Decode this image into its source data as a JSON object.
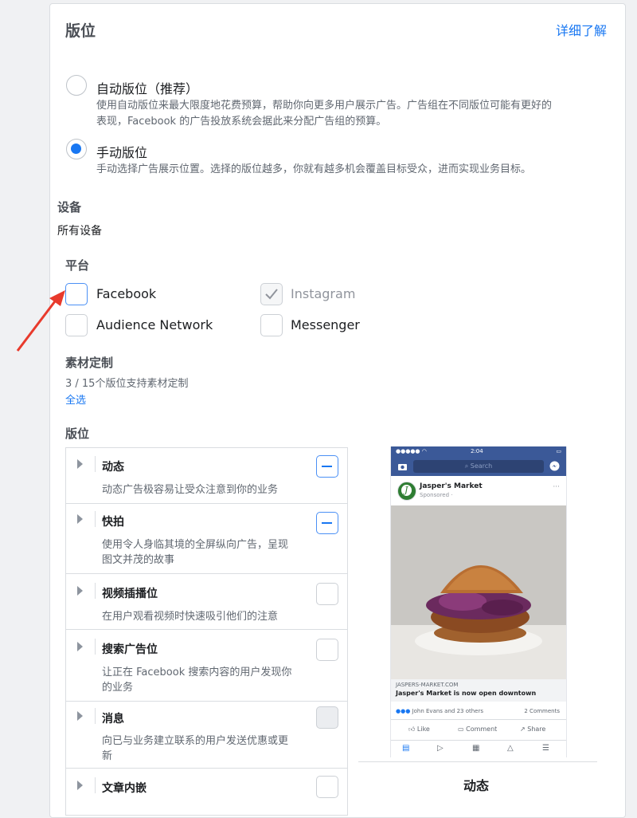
{
  "header": {
    "title": "版位",
    "learn_more": "详细了解"
  },
  "placement_mode": {
    "auto": {
      "label": "自动版位（推荐）",
      "desc_line1": "使用自动版位来最大限度地花费预算，帮助你向更多用户展示广告。广告组在不同版位可能有更好的",
      "desc_line2": "表现，Facebook 的广告投放系统会据此来分配广告组的预算。",
      "selected": false
    },
    "manual": {
      "label": "手动版位",
      "desc": "手动选择广告展示位置。选择的版位越多，你就有越多机会覆盖目标受众，进而实现业务目标。",
      "selected": true
    }
  },
  "devices": {
    "heading": "设备",
    "value": "所有设备"
  },
  "platforms": {
    "heading": "平台",
    "items": [
      {
        "label": "Facebook",
        "checked": false,
        "disabled": false
      },
      {
        "label": "Instagram",
        "checked": true,
        "disabled": true
      },
      {
        "label": "Audience Network",
        "checked": false,
        "disabled": false
      },
      {
        "label": "Messenger",
        "checked": false,
        "disabled": false
      }
    ]
  },
  "asset_customization": {
    "heading": "素材定制",
    "count_text": "3 / 15个版位支持素材定制",
    "select_all": "全选"
  },
  "placements": {
    "heading": "版位",
    "items": [
      {
        "name": "动态",
        "desc": "动态广告极容易让受众注意到你的业务",
        "state": "partial"
      },
      {
        "name": "快拍",
        "desc1": "使用令人身临其境的全屏纵向广告，呈现",
        "desc2": "图文并茂的故事",
        "state": "partial"
      },
      {
        "name": "视频插播位",
        "desc": "在用户观看视频时快速吸引他们的注意",
        "state": "empty"
      },
      {
        "name": "搜索广告位",
        "desc1": "让正在 Facebook 搜索内容的用户发现你",
        "desc2": "的业务",
        "state": "empty"
      },
      {
        "name": "消息",
        "desc1": "向已与业务建立联系的用户发送优惠或更",
        "desc2": "新",
        "state": "disabled"
      },
      {
        "name": "文章内嵌",
        "desc": "",
        "state": "empty"
      }
    ]
  },
  "preview": {
    "status_time": "2:04",
    "search_placeholder": "Search",
    "page_name": "Jasper's Market",
    "sponsored": "Sponsored · ",
    "link_domain": "JASPERS-MARKET.COM",
    "link_title": "Jasper's Market is now open downtown",
    "reactions_text": "John Evans and 23 others",
    "comments_text": "2 Comments",
    "actions": [
      "Like",
      "Comment",
      "Share"
    ],
    "caption": "动态"
  },
  "colors": {
    "accent": "#1877f2",
    "fb_bar": "#3b5998",
    "arrow": "#e83a2c"
  }
}
